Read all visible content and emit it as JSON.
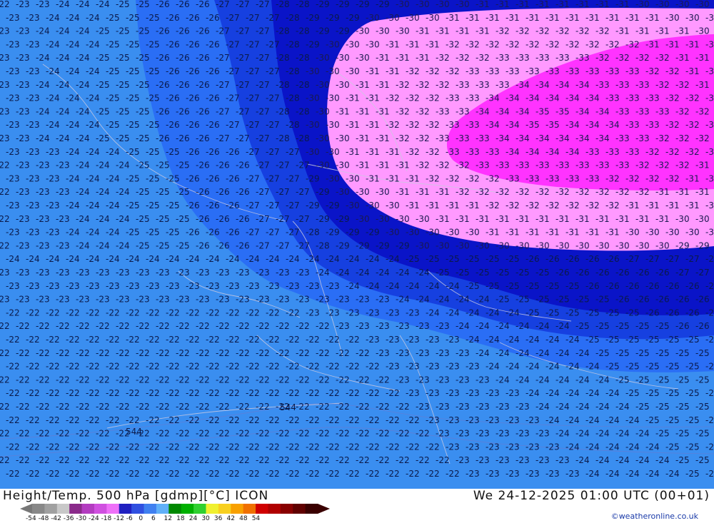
{
  "map": {
    "contour_values": [
      22,
      23,
      24,
      25,
      26,
      27,
      28,
      29,
      30,
      31,
      32,
      33,
      34,
      35
    ],
    "height_marker": "544",
    "colors": {
      "band_light": "#3a8ef0",
      "band_mid": "#2a6ef5",
      "band_blue": "#1640e0",
      "band_dark": "#0a14c8",
      "band_pink": "#ff99ff",
      "band_magenta": "#ff33ff"
    }
  },
  "footer": {
    "title": "Height/Temp. 500 hPa [gdmp][°C] ICON",
    "datetime": "We 24-12-2025 01:00 UTC (00+01)",
    "credit": "©weatheronline.co.uk",
    "scale_ticks": [
      "-54",
      "-48",
      "-42",
      "-36",
      "-30",
      "-24",
      "-18",
      "-12",
      "-6",
      "0",
      "6",
      "12",
      "18",
      "24",
      "30",
      "36",
      "42",
      "48",
      "54"
    ],
    "scale_colors": [
      "#888888",
      "#a0a0a0",
      "#c8c8c8",
      "#8a2a8a",
      "#b33cc0",
      "#d050e0",
      "#ee70f8",
      "#2020c0",
      "#3050e0",
      "#4080f0",
      "#60b0f8",
      "#008800",
      "#00b000",
      "#30d030",
      "#f0f030",
      "#f8d020",
      "#f8a000",
      "#f07000",
      "#d00000",
      "#b00000",
      "#880000",
      "#600000",
      "#3a0000"
    ]
  }
}
